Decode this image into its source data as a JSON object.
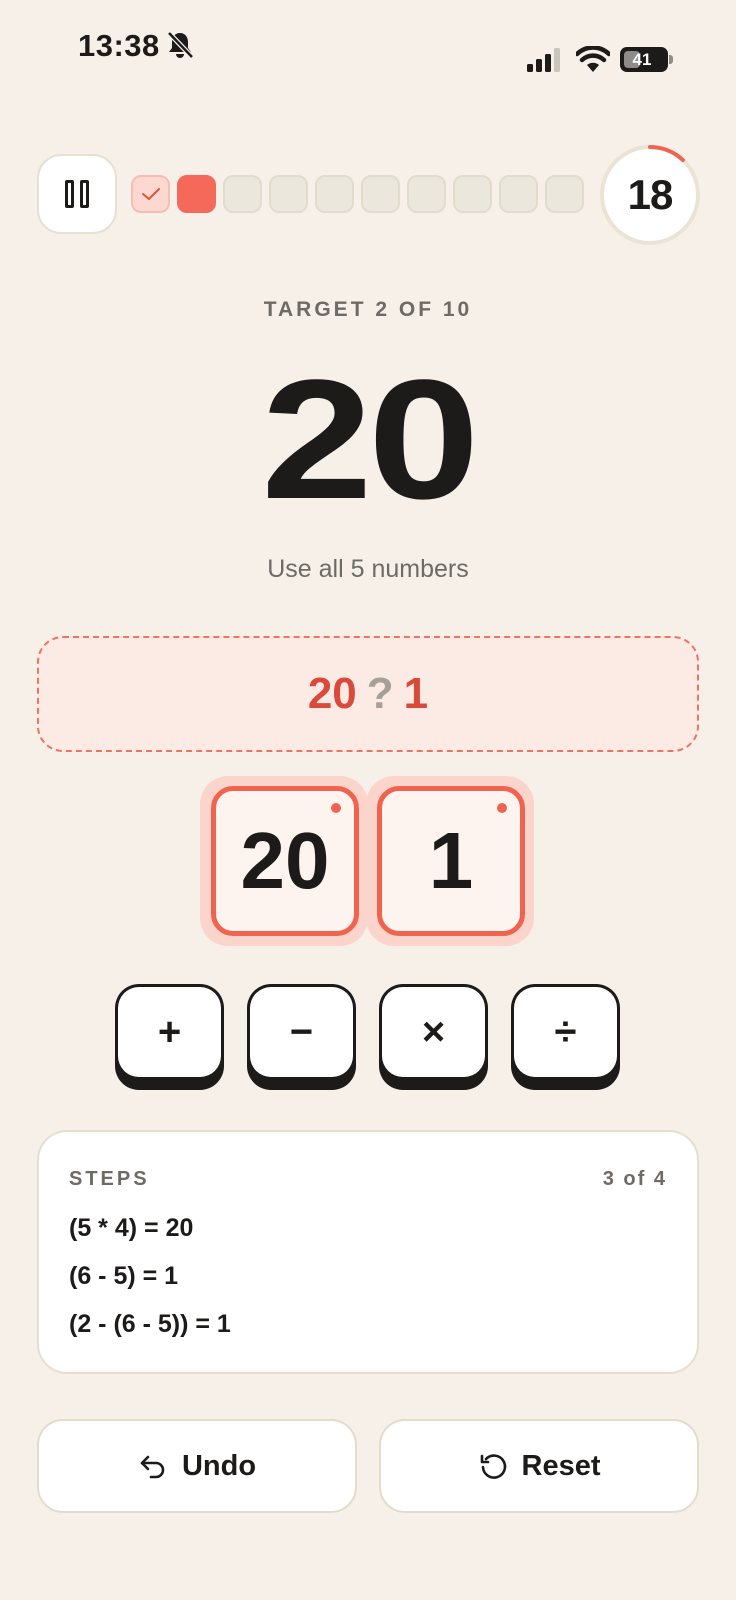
{
  "status_bar": {
    "time": "13:38",
    "battery": "41",
    "battery_level": 0.41,
    "icons": [
      "bell-muted-icon",
      "signal-icon",
      "wifi-icon",
      "battery-icon"
    ]
  },
  "game": {
    "progress": {
      "total": 10,
      "current": 2,
      "states": [
        "done",
        "current",
        "empty",
        "empty",
        "empty",
        "empty",
        "empty",
        "empty",
        "empty",
        "empty"
      ]
    },
    "timer": {
      "value": "18",
      "remaining_fraction": 0.12
    },
    "target_label": "TARGET 2 OF 10",
    "target_value": "20",
    "subtitle": "Use all 5 numbers",
    "expression": {
      "left": "20",
      "operator": "?",
      "right": "1"
    },
    "tiles": [
      "20",
      "1"
    ],
    "operators": [
      {
        "symbol": "+",
        "name": "plus"
      },
      {
        "symbol": "−",
        "name": "minus"
      },
      {
        "symbol": "×",
        "name": "multiply"
      },
      {
        "symbol": "÷",
        "name": "divide"
      }
    ],
    "steps": {
      "title": "STEPS",
      "count": "3 of 4",
      "lines": [
        "(5 * 4) = 20",
        "(6 - 5) = 1",
        "(2 - (6 - 5)) = 1"
      ]
    },
    "actions": {
      "undo": "Undo",
      "reset": "Reset"
    }
  },
  "colors": {
    "background": "#f6f0e9",
    "accent": "#f0634f",
    "accent_dark": "#d94a3a",
    "text": "#1c1b1a",
    "muted": "#6e6a65"
  }
}
